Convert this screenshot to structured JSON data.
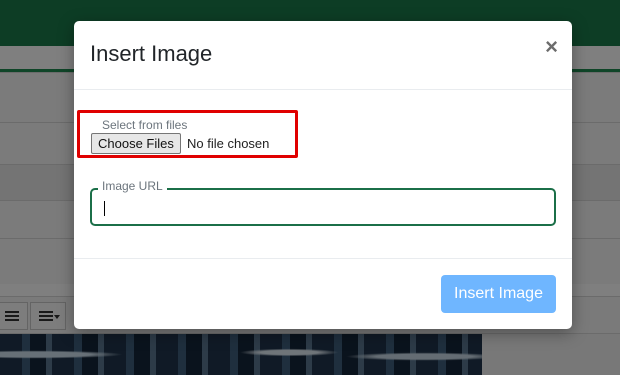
{
  "modal": {
    "title": "Insert Image",
    "close_symbol": "×",
    "file_field": {
      "label": "Select from files",
      "button_label": "Choose Files",
      "status": "No file chosen"
    },
    "url_field": {
      "label": "Image URL",
      "value": ""
    },
    "submit_label": "Insert Image"
  },
  "icons": {
    "close": "close-icon",
    "list": "ordered-list-icon",
    "align": "align-icon"
  },
  "colors": {
    "header_green": "#1b7a4a",
    "input_border": "#1b6f48",
    "highlight_red": "#e00000",
    "submit_button": "#6fb6ff"
  }
}
